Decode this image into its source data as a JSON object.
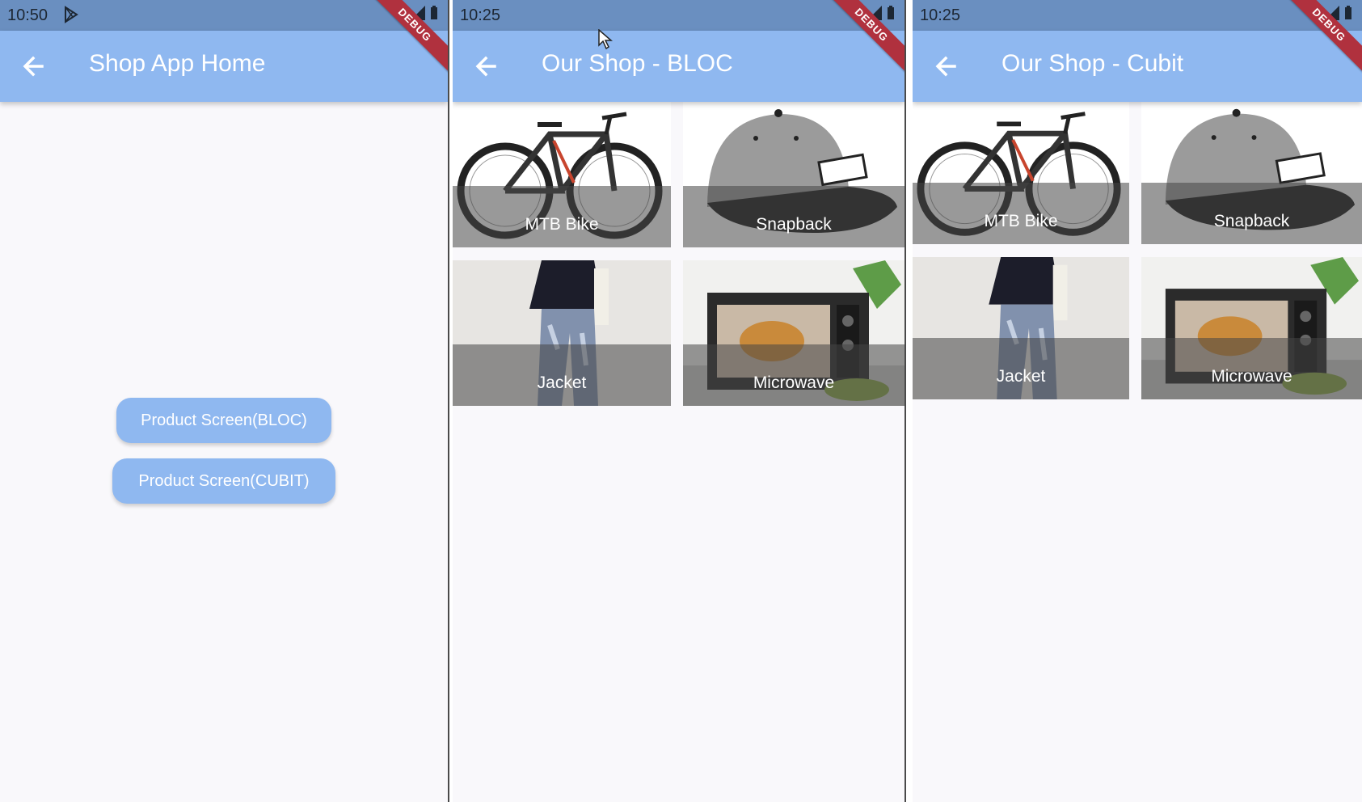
{
  "screens": [
    {
      "status_time": "10:50",
      "title": "Shop App Home",
      "buttons": [
        "Product Screen(BLOC)",
        "Product Screen(CUBIT)"
      ]
    },
    {
      "status_time": "10:25",
      "title": "Our Shop - BLOC",
      "products": [
        "MTB Bike",
        "Snapback",
        "Jacket",
        "Microwave"
      ]
    },
    {
      "status_time": "10:25",
      "title": "Our Shop - Cubit",
      "products": [
        "MTB Bike",
        "Snapback",
        "Jacket",
        "Microwave"
      ]
    }
  ],
  "debug_label": "DEBUG",
  "colors": {
    "app_bar": "#8fb8f0",
    "status_bar": "#6a8fc0",
    "background": "#f9f8fb",
    "debug_banner": "#b0313e"
  },
  "icons": [
    "back-arrow-icon",
    "play-store-icon",
    "wifi-icon",
    "signal-icon",
    "battery-icon",
    "mouse-cursor-icon"
  ]
}
